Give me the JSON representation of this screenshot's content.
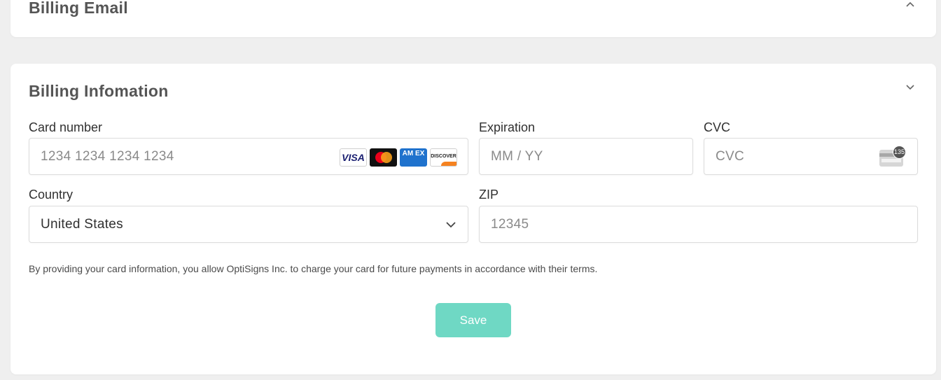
{
  "billing_email": {
    "title": "Billing Email",
    "chevron_icon": "chevron-up-icon"
  },
  "billing_info": {
    "title": "Billing Infomation",
    "chevron_icon": "chevron-down-icon",
    "card_number": {
      "label": "Card number",
      "placeholder": "1234 1234 1234 1234",
      "brands": {
        "visa": "VISA",
        "mastercard_icon": "mastercard-icon",
        "amex": "AM EX",
        "discover": "DISCOVER"
      }
    },
    "expiration": {
      "label": "Expiration",
      "placeholder": "MM / YY"
    },
    "cvc": {
      "label": "CVC",
      "placeholder": "CVC",
      "badge": "135"
    },
    "country": {
      "label": "Country",
      "value": "United States"
    },
    "zip": {
      "label": "ZIP",
      "placeholder": "12345"
    },
    "disclaimer": "By providing your card information, you allow OptiSigns Inc. to charge your card for future payments in accordance with their terms.",
    "save_label": "Save"
  },
  "colors": {
    "page_bg": "#efefef",
    "card_bg": "#ffffff",
    "save_button": "#6fd8c4",
    "title_text": "#555555"
  }
}
